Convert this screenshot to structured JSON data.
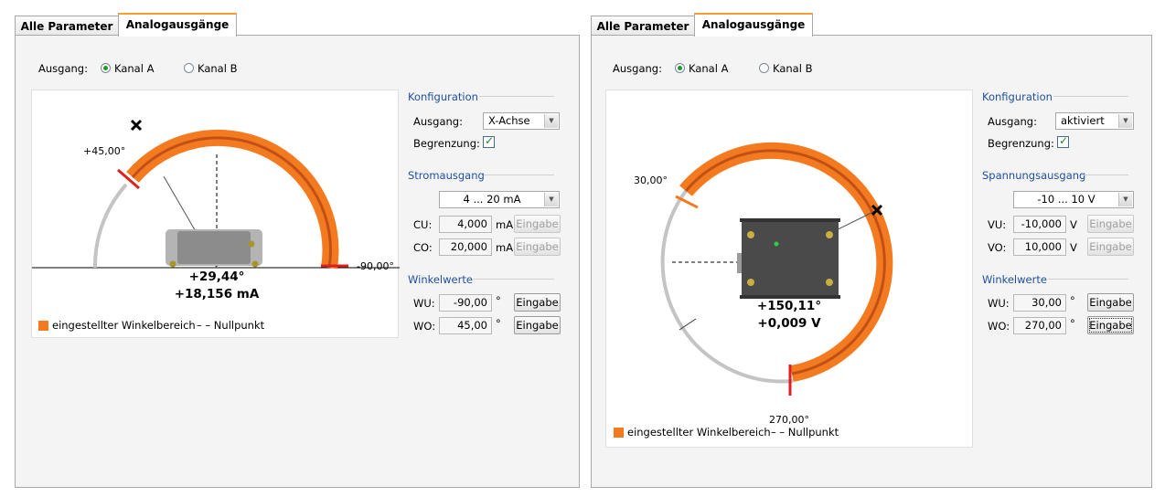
{
  "colors": {
    "accent": "#f47a20",
    "accent_dark": "#c0501a",
    "marker": "#e02020",
    "gray_arc": "#c4c4c4",
    "section_title": "#1f4fa0"
  },
  "left": {
    "tabs": [
      {
        "label": "Alle Parameter"
      },
      {
        "label": "Analogausgänge"
      }
    ],
    "output_label": "Ausgang:",
    "channel_a": "Kanal A",
    "channel_b": "Kanal B",
    "selected_channel": "Kanal A",
    "angle_top_label": "+45,00°",
    "angle_right_label": "-90,00°",
    "readout_angle": "+29,44°",
    "readout_value": "+18,156 mA",
    "legend_range": "eingestellter Winkelbereich",
    "legend_zero": "– – Nullpunkt",
    "config": {
      "title": "Konfiguration",
      "output_label": "Ausgang:",
      "output_value": "X-Achse",
      "limit_label": "Begrenzung:",
      "limit_checked": true
    },
    "current": {
      "title": "Stromausgang",
      "range_value": "4 ... 20 mA",
      "cu_label": "CU:",
      "cu_value": "4,000",
      "cu_unit": "mA",
      "co_label": "CO:",
      "co_value": "20,000",
      "co_unit": "mA",
      "button": "Eingabe"
    },
    "angles": {
      "title": "Winkelwerte",
      "wu_label": "WU:",
      "wu_value": "-90,00",
      "wo_label": "WO:",
      "wo_value": "45,00",
      "unit": "°",
      "button": "Eingabe"
    }
  },
  "right": {
    "tabs": [
      {
        "label": "Alle Parameter"
      },
      {
        "label": "Analogausgänge"
      }
    ],
    "output_label": "Ausgang:",
    "channel_a": "Kanal A",
    "channel_b": "Kanal B",
    "selected_channel": "Kanal A",
    "angle_top_label": "30,00°",
    "angle_bottom_label": "270,00°",
    "readout_angle": "+150,11°",
    "readout_value": "+0,009 V",
    "legend_range": "eingestellter Winkelbereich",
    "legend_zero": "– – Nullpunkt",
    "config": {
      "title": "Konfiguration",
      "output_label": "Ausgang:",
      "output_value": "aktiviert",
      "limit_label": "Begrenzung:",
      "limit_checked": true
    },
    "voltage": {
      "title": "Spannungsausgang",
      "range_value": "-10 ... 10 V",
      "vu_label": "VU:",
      "vu_value": "-10,000",
      "vu_unit": "V",
      "vo_label": "VO:",
      "vo_value": "10,000",
      "vo_unit": "V",
      "button": "Eingabe"
    },
    "angles": {
      "title": "Winkelwerte",
      "wu_label": "WU:",
      "wu_value": "30,00",
      "wo_label": "WO:",
      "wo_value": "270,00",
      "unit": "°",
      "button": "Eingabe"
    }
  }
}
